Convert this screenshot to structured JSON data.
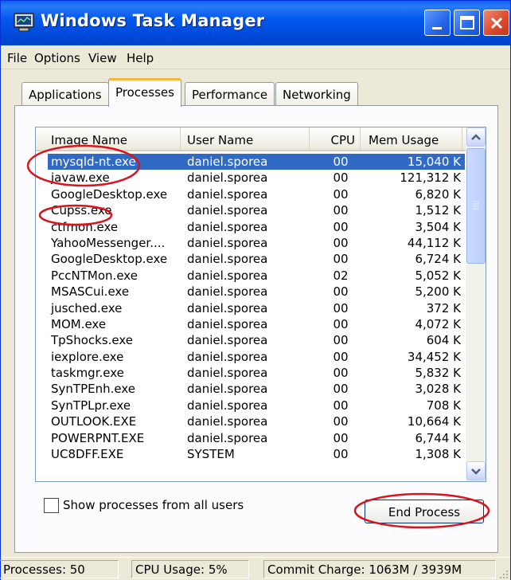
{
  "window": {
    "title": "Windows Task Manager",
    "icon": "task-manager-icon",
    "controls": [
      "minimize-icon",
      "maximize-icon",
      "close-icon"
    ]
  },
  "menu": {
    "items": [
      "File",
      "Options",
      "View",
      "Help"
    ]
  },
  "tabs": [
    {
      "label": "Applications",
      "active": false
    },
    {
      "label": "Processes",
      "active": true
    },
    {
      "label": "Performance",
      "active": false
    },
    {
      "label": "Networking",
      "active": false
    }
  ],
  "processes": {
    "columns": [
      "Image Name",
      "User Name",
      "CPU",
      "Mem Usage"
    ],
    "rows": [
      {
        "name": "mysqld-nt.exe",
        "user": "daniel.sporea",
        "cpu": "00",
        "mem": "15,040 K",
        "selected": true
      },
      {
        "name": "javaw.exe",
        "user": "daniel.sporea",
        "cpu": "00",
        "mem": "121,312 K"
      },
      {
        "name": "GoogleDesktop.exe",
        "user": "daniel.sporea",
        "cpu": "00",
        "mem": "6,820 K"
      },
      {
        "name": "Cupss.exe",
        "user": "daniel.sporea",
        "cpu": "00",
        "mem": "1,512 K"
      },
      {
        "name": "ctfmon.exe",
        "user": "daniel.sporea",
        "cpu": "00",
        "mem": "3,504 K"
      },
      {
        "name": "YahooMessenger....",
        "user": "daniel.sporea",
        "cpu": "00",
        "mem": "44,112 K"
      },
      {
        "name": "GoogleDesktop.exe",
        "user": "daniel.sporea",
        "cpu": "00",
        "mem": "6,724 K"
      },
      {
        "name": "PccNTMon.exe",
        "user": "daniel.sporea",
        "cpu": "02",
        "mem": "5,052 K"
      },
      {
        "name": "MSASCui.exe",
        "user": "daniel.sporea",
        "cpu": "00",
        "mem": "5,200 K"
      },
      {
        "name": "jusched.exe",
        "user": "daniel.sporea",
        "cpu": "00",
        "mem": "372 K"
      },
      {
        "name": "MOM.exe",
        "user": "daniel.sporea",
        "cpu": "00",
        "mem": "4,072 K"
      },
      {
        "name": "TpShocks.exe",
        "user": "daniel.sporea",
        "cpu": "00",
        "mem": "604 K"
      },
      {
        "name": "iexplore.exe",
        "user": "daniel.sporea",
        "cpu": "00",
        "mem": "34,452 K"
      },
      {
        "name": "taskmgr.exe",
        "user": "daniel.sporea",
        "cpu": "00",
        "mem": "5,832 K"
      },
      {
        "name": "SynTPEnh.exe",
        "user": "daniel.sporea",
        "cpu": "00",
        "mem": "3,028 K"
      },
      {
        "name": "SynTPLpr.exe",
        "user": "daniel.sporea",
        "cpu": "00",
        "mem": "708 K"
      },
      {
        "name": "OUTLOOK.EXE",
        "user": "daniel.sporea",
        "cpu": "00",
        "mem": "10,664 K"
      },
      {
        "name": "POWERPNT.EXE",
        "user": "daniel.sporea",
        "cpu": "00",
        "mem": "6,744 K"
      },
      {
        "name": "UC8DFF.EXE",
        "user": "SYSTEM",
        "cpu": "00",
        "mem": "1,308 K"
      }
    ]
  },
  "show_all_users": {
    "label": "Show processes from all users",
    "checked": false
  },
  "end_process_label": "End Process",
  "status": {
    "processes": "Processes: 50",
    "cpu_usage": "CPU Usage: 5%",
    "commit_charge": "Commit Charge: 1063M / 3939M"
  },
  "annotation_color": "#d8141e"
}
